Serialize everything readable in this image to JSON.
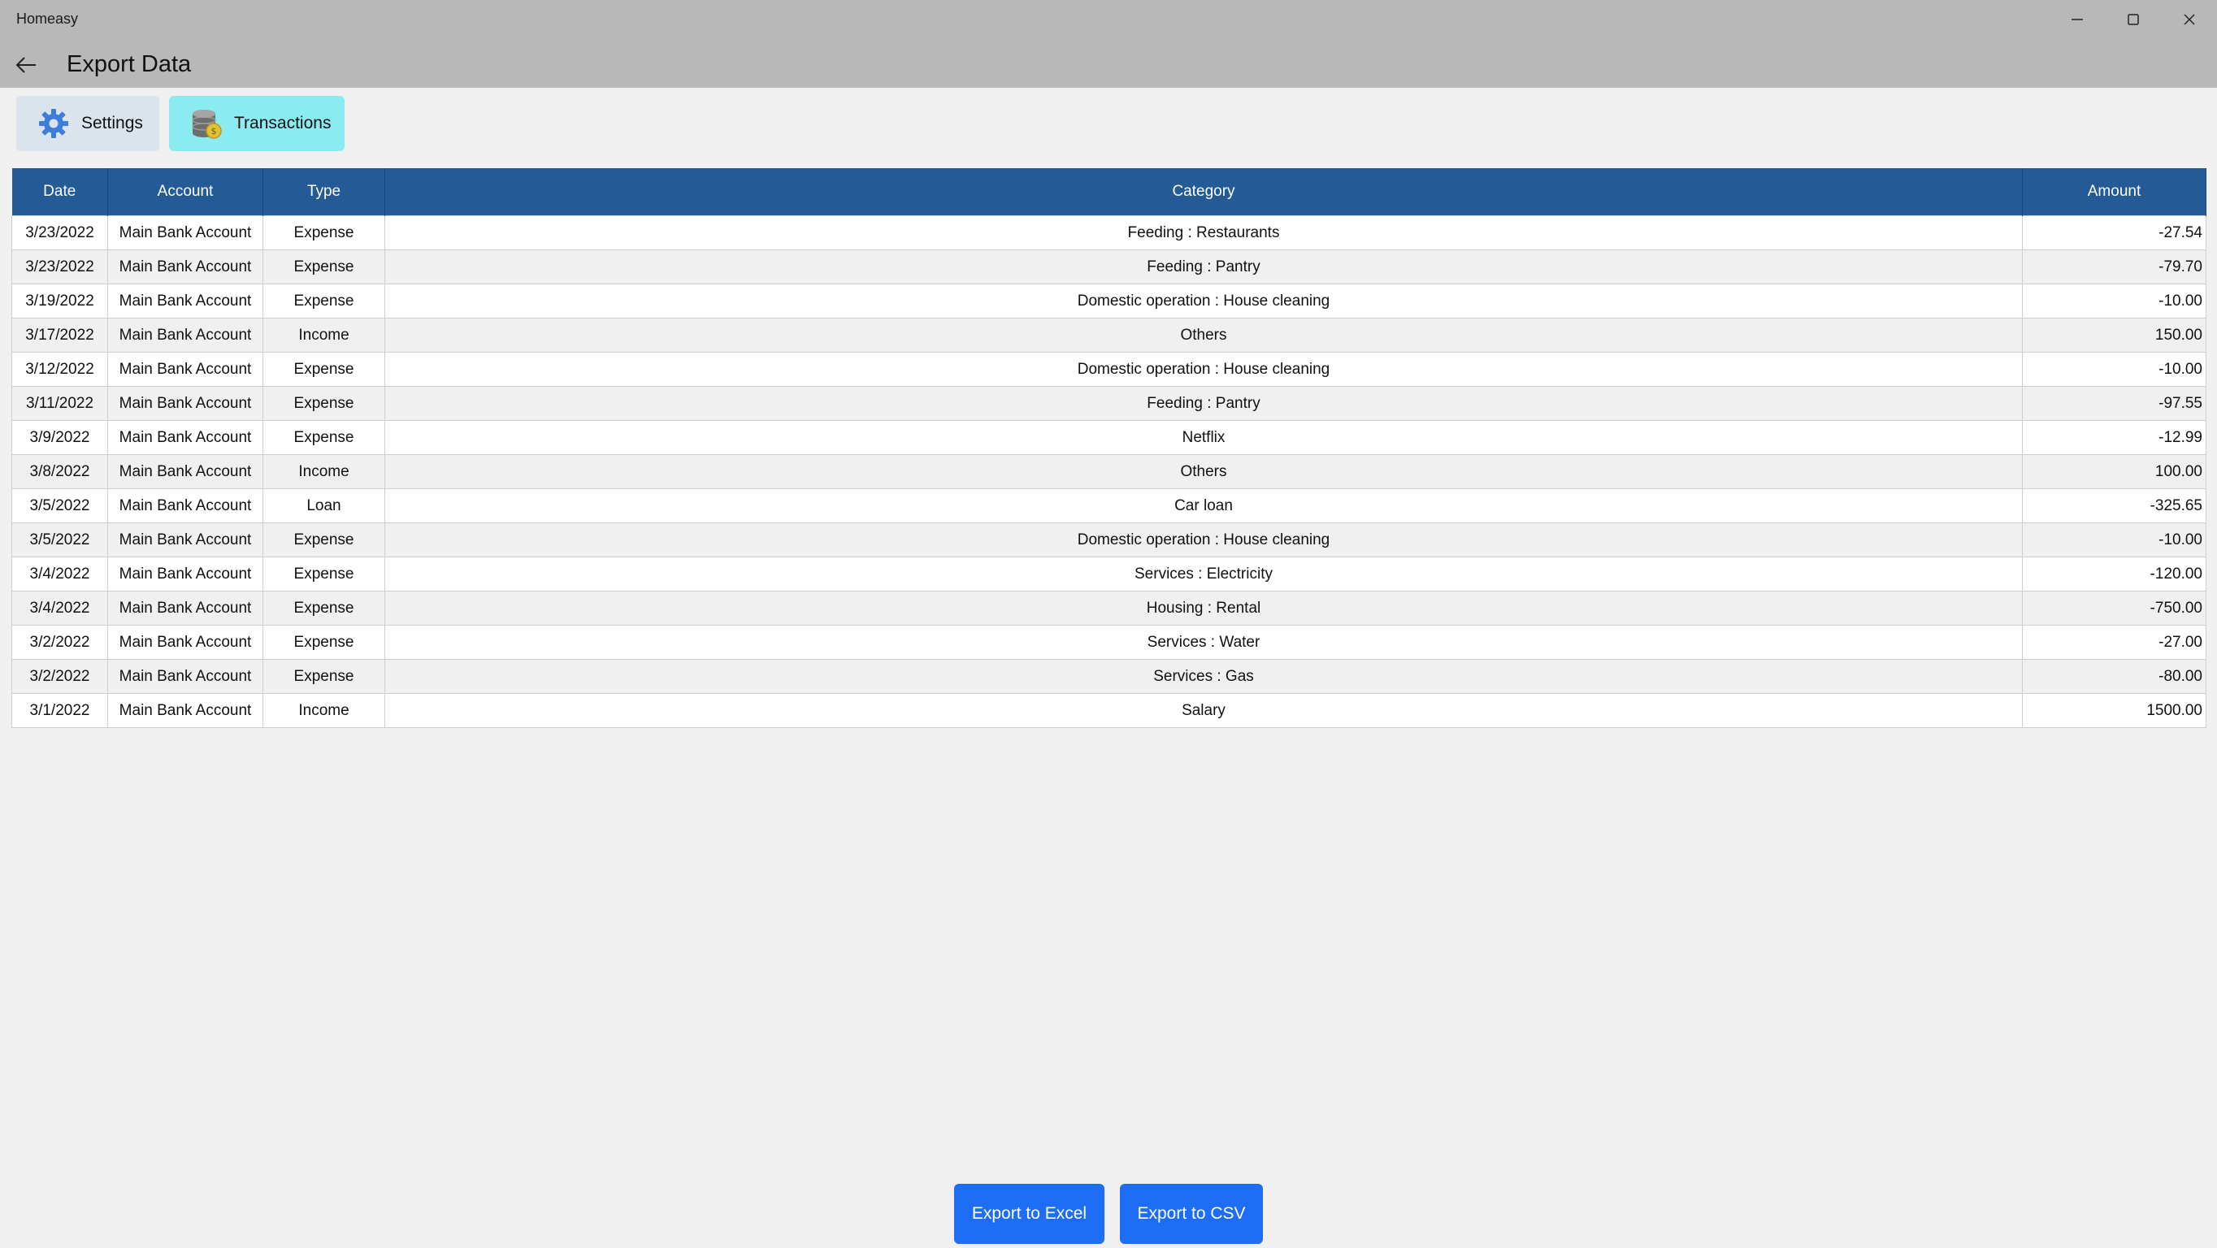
{
  "app": {
    "title": "Homeasy"
  },
  "header": {
    "title": "Export Data"
  },
  "tabs": [
    {
      "label": "Settings",
      "icon": "gear-icon"
    },
    {
      "label": "Transactions",
      "icon": "database-coin-icon"
    }
  ],
  "table": {
    "columns": [
      "Date",
      "Account",
      "Type",
      "Category",
      "Amount"
    ],
    "rows": [
      [
        "3/23/2022",
        "Main Bank Account",
        "Expense",
        "Feeding : Restaurants",
        "-27.54"
      ],
      [
        "3/23/2022",
        "Main Bank Account",
        "Expense",
        "Feeding : Pantry",
        "-79.70"
      ],
      [
        "3/19/2022",
        "Main Bank Account",
        "Expense",
        "Domestic operation : House cleaning",
        "-10.00"
      ],
      [
        "3/17/2022",
        "Main Bank Account",
        "Income",
        "Others",
        "150.00"
      ],
      [
        "3/12/2022",
        "Main Bank Account",
        "Expense",
        "Domestic operation : House cleaning",
        "-10.00"
      ],
      [
        "3/11/2022",
        "Main Bank Account",
        "Expense",
        "Feeding : Pantry",
        "-97.55"
      ],
      [
        "3/9/2022",
        "Main Bank Account",
        "Expense",
        "Netflix",
        "-12.99"
      ],
      [
        "3/8/2022",
        "Main Bank Account",
        "Income",
        "Others",
        "100.00"
      ],
      [
        "3/5/2022",
        "Main Bank Account",
        "Loan",
        "Car loan",
        "-325.65"
      ],
      [
        "3/5/2022",
        "Main Bank Account",
        "Expense",
        "Domestic operation : House cleaning",
        "-10.00"
      ],
      [
        "3/4/2022",
        "Main Bank Account",
        "Expense",
        "Services : Electricity",
        "-120.00"
      ],
      [
        "3/4/2022",
        "Main Bank Account",
        "Expense",
        "Housing : Rental",
        "-750.00"
      ],
      [
        "3/2/2022",
        "Main Bank Account",
        "Expense",
        "Services : Water",
        "-27.00"
      ],
      [
        "3/2/2022",
        "Main Bank Account",
        "Expense",
        "Services : Gas",
        "-80.00"
      ],
      [
        "3/1/2022",
        "Main Bank Account",
        "Income",
        "Salary",
        "1500.00"
      ]
    ]
  },
  "actions": {
    "export_excel": "Export to Excel",
    "export_csv": "Export to CSV"
  },
  "colors": {
    "header_bg": "#245a96",
    "accent_button": "#1d6ef5",
    "active_tab": "#8aecf0"
  }
}
